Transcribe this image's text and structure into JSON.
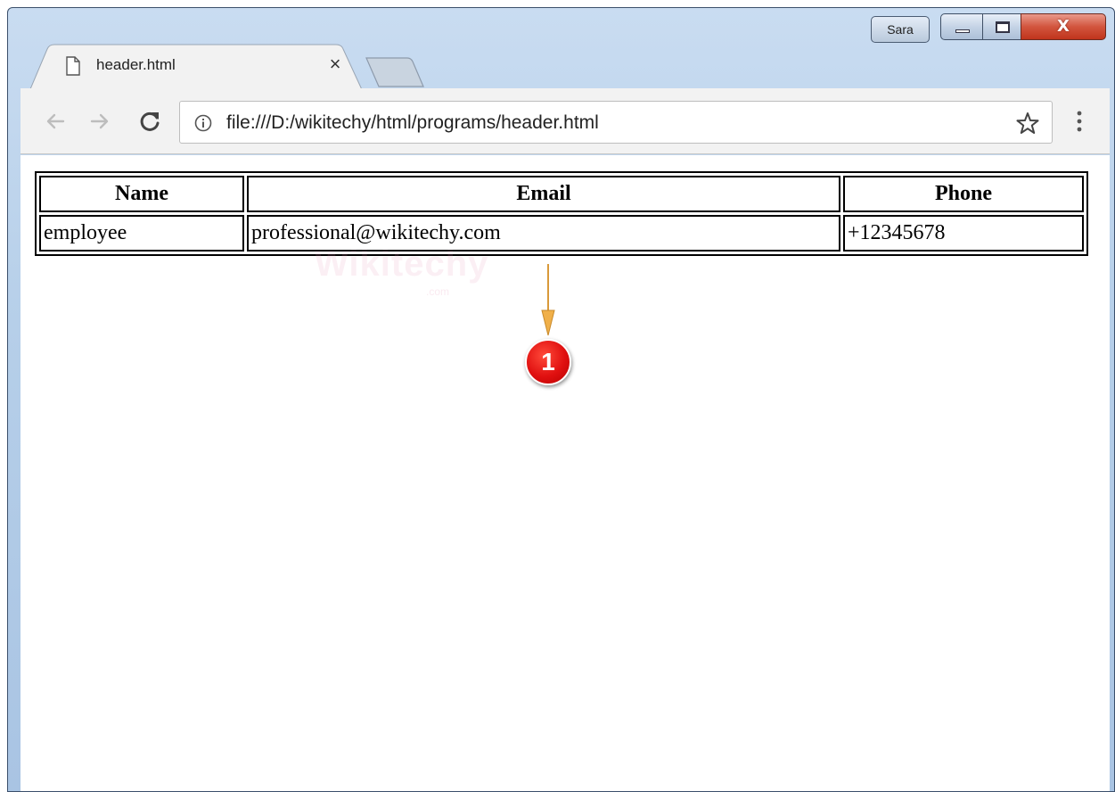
{
  "browser": {
    "tab_title": "header.html",
    "tab_close_glyph": "×",
    "profile_name": "Sara",
    "url": "file:///D:/wikitechy/html/programs/header.html",
    "icons": [
      "page-icon",
      "close-icon",
      "new-tab-button",
      "back-arrow-icon",
      "forward-arrow-icon",
      "reload-icon",
      "info-icon",
      "star-icon",
      "menu-kebab-icon",
      "minimize-icon",
      "maximize-icon",
      "close-window-icon"
    ],
    "colors": {
      "frame": "#b6cfe9",
      "toolbar": "#f2f2f2",
      "close_button": "#c0341c"
    }
  },
  "table": {
    "headers": [
      "Name",
      "Email",
      "Phone"
    ],
    "rows": [
      [
        "employee",
        "professional@wikitechy.com",
        "+12345678"
      ]
    ]
  },
  "watermark": {
    "text": "Wikitechy",
    "subtext": ".com"
  },
  "annotation": {
    "badge_number": "1",
    "arrow_color": "#f0b04a",
    "badge_color": "#e01010"
  }
}
